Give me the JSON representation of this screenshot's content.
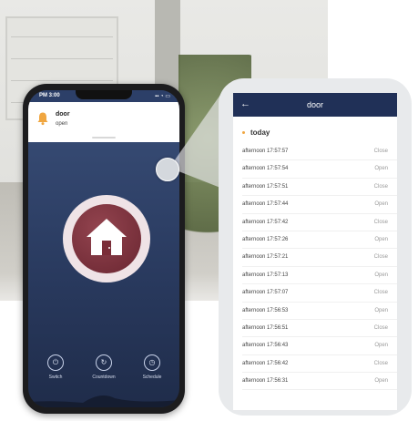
{
  "colors": {
    "phone_header": "#2c3f68",
    "phone_gradient_top": "#3a4f79",
    "house_button": "#6a2631",
    "panel_header": "#203057",
    "accent_dot": "#f0a640",
    "status_text": "#9a9a9a"
  },
  "phone": {
    "status_time": "PM 3:00",
    "notification": {
      "icon": "bell-icon",
      "title": "door",
      "status": "open"
    },
    "main_button_icon": "house-icon",
    "nav": [
      {
        "label": "Switch",
        "icon": "power-icon"
      },
      {
        "label": "Countdown",
        "icon": "countdown-icon"
      },
      {
        "label": "Schedule",
        "icon": "clock-icon"
      }
    ]
  },
  "history": {
    "back_icon": "back-arrow-icon",
    "title": "door",
    "section": "today",
    "records": [
      {
        "time": "afternoon 17:57:57",
        "status": "Close"
      },
      {
        "time": "afternoon 17:57:54",
        "status": "Open"
      },
      {
        "time": "afternoon 17:57:51",
        "status": "Close"
      },
      {
        "time": "afternoon 17:57:44",
        "status": "Open"
      },
      {
        "time": "afternoon 17:57:42",
        "status": "Close"
      },
      {
        "time": "afternoon 17:57:26",
        "status": "Open"
      },
      {
        "time": "afternoon 17:57:21",
        "status": "Close"
      },
      {
        "time": "afternoon 17:57:13",
        "status": "Open"
      },
      {
        "time": "afternoon 17:57:07",
        "status": "Close"
      },
      {
        "time": "afternoon 17:56:53",
        "status": "Open"
      },
      {
        "time": "afternoon 17:56:51",
        "status": "Close"
      },
      {
        "time": "afternoon 17:56:43",
        "status": "Open"
      },
      {
        "time": "afternoon 17:56:42",
        "status": "Close"
      },
      {
        "time": "afternoon 17:56:31",
        "status": "Open"
      }
    ]
  }
}
